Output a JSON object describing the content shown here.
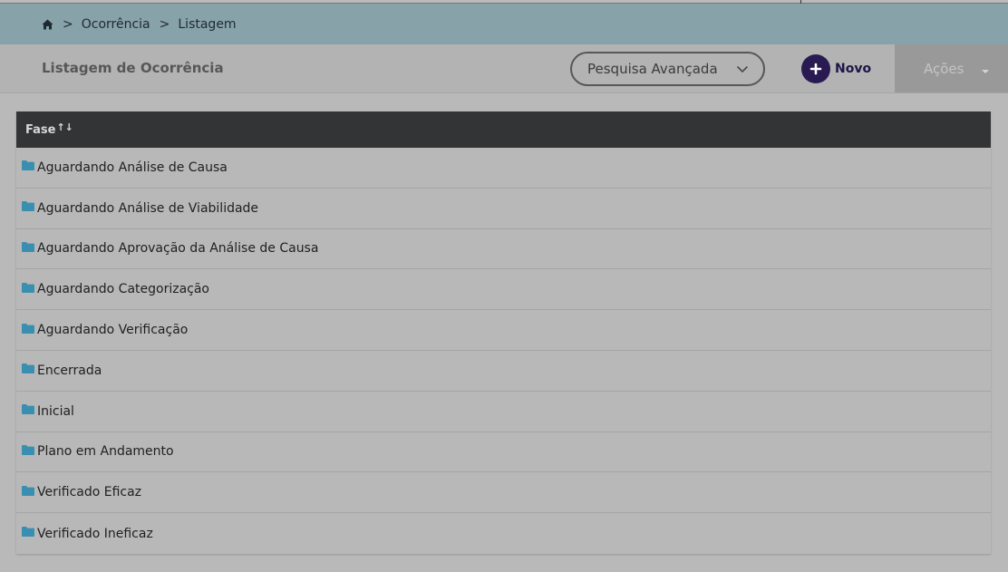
{
  "breadcrumb": {
    "home_icon": "home-icon",
    "separator": ">",
    "items": [
      "Ocorrência",
      "Listagem"
    ]
  },
  "header": {
    "title": "Listagem de Ocorrência",
    "search_label": "Pesquisa Avançada",
    "new_label": "Novo",
    "actions_label": "Ações"
  },
  "table": {
    "column_header": "Fase",
    "sort_icon": "↑↓",
    "rows": [
      "Aguardando Análise de Causa",
      "Aguardando Análise de Viabilidade",
      "Aguardando Aprovação da Análise de Causa",
      "Aguardando Categorização",
      "Aguardando Verificação",
      "Encerrada",
      "Inicial",
      "Plano em Andamento",
      "Verificado Eficaz",
      "Verificado Ineficaz"
    ]
  },
  "colors": {
    "breadcrumb_bg": "#88a2aa",
    "header_bg": "#b3b3b3",
    "table_header_bg": "#333436",
    "folder_icon": "#3a8fb0",
    "new_button_bg": "#2a1a52",
    "actions_bg": "#999999"
  }
}
